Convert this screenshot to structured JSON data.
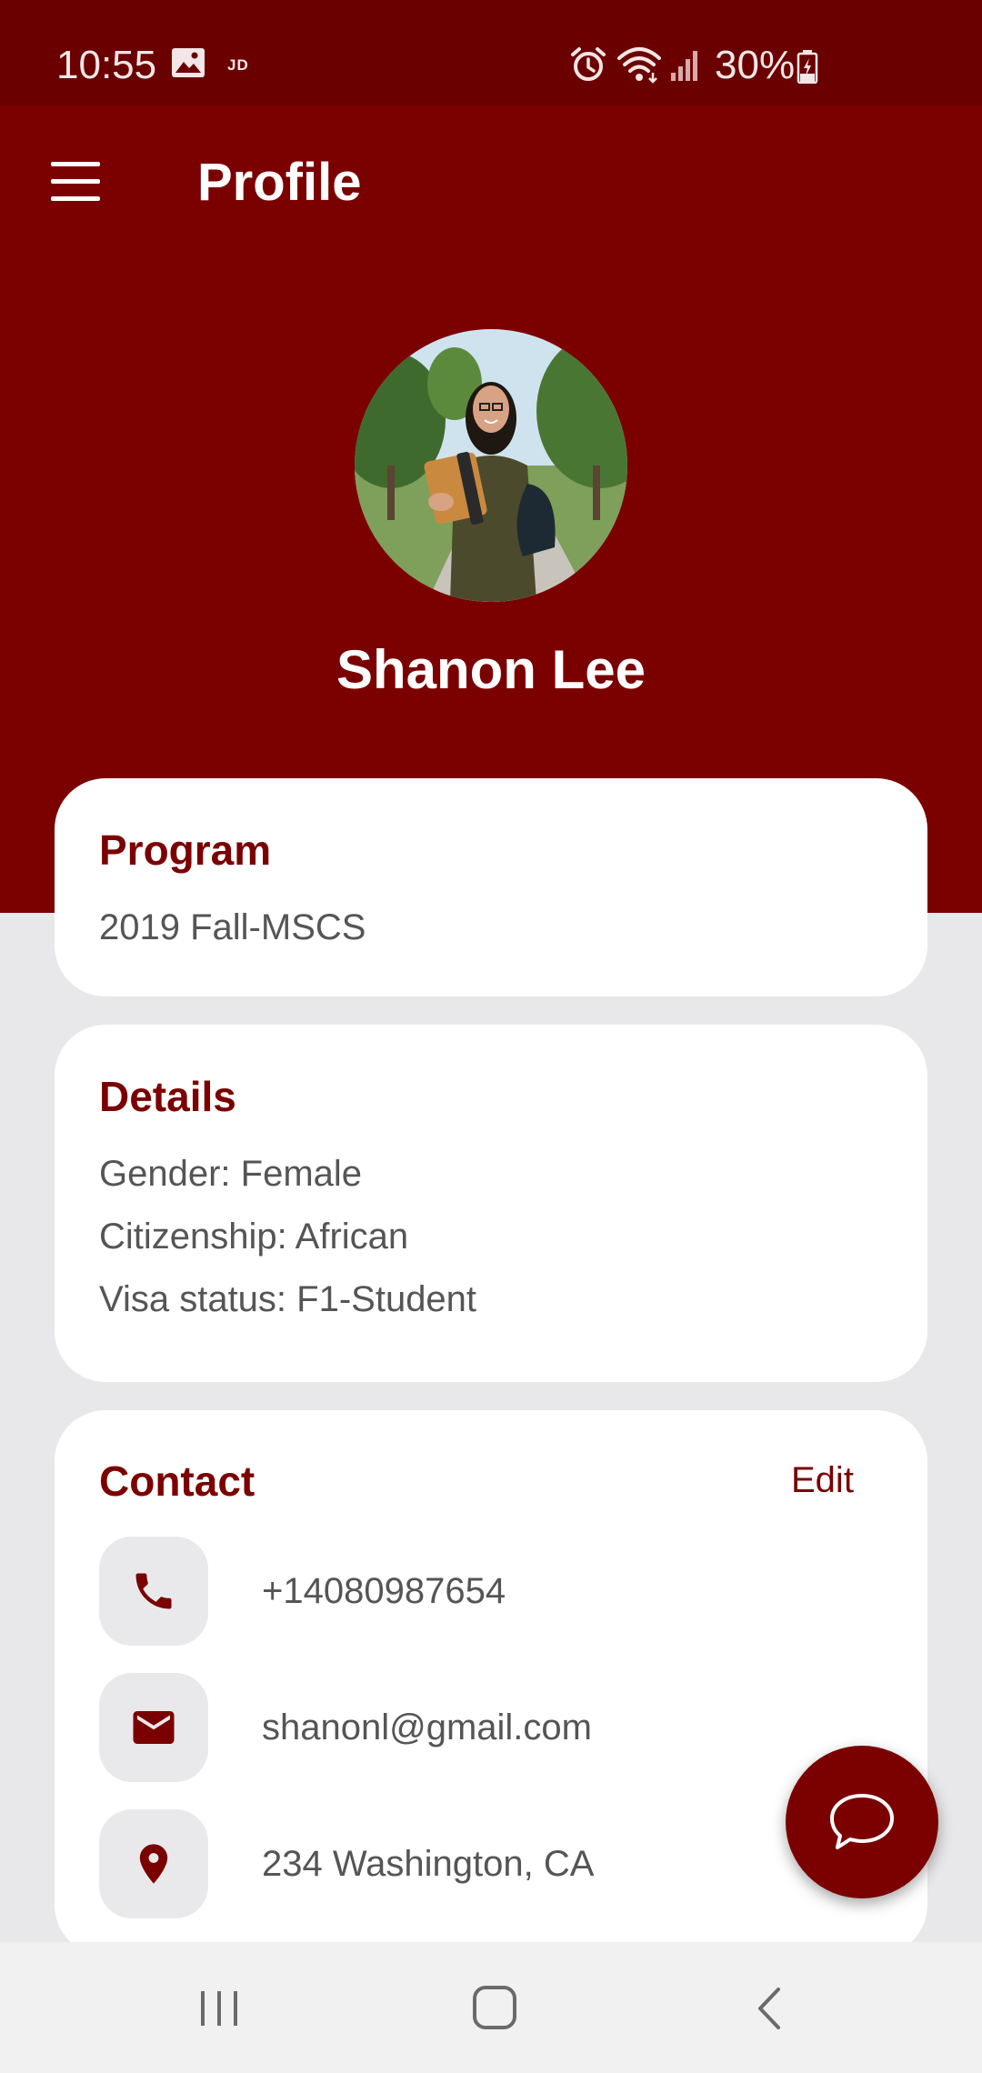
{
  "status_bar": {
    "time": "10:55",
    "notification_icons": [
      "gallery-icon",
      "jd-icon"
    ],
    "jd_label": "JD",
    "system_icons": [
      "alarm-icon",
      "wifi-icon",
      "signal-icon"
    ],
    "battery_percent": "30%",
    "battery_level": 0.3
  },
  "header": {
    "menu_icon": "hamburger-menu-icon",
    "title": "Profile"
  },
  "profile": {
    "name": "Shanon Lee",
    "avatar": "profile-photo"
  },
  "program": {
    "title": "Program",
    "value": "2019 Fall-MSCS"
  },
  "details": {
    "title": "Details",
    "items": [
      "Gender: Female",
      "Citizenship: African",
      "Visa status: F1-Student"
    ]
  },
  "contact": {
    "title": "Contact",
    "edit_label": "Edit",
    "items": [
      {
        "icon": "phone-icon",
        "value": "+14080987654"
      },
      {
        "icon": "email-icon",
        "value": "shanonl@gmail.com"
      },
      {
        "icon": "location-pin-icon",
        "value": "234 Washington, CA"
      }
    ]
  },
  "fab": {
    "icon": "chat-bubble-icon"
  },
  "nav_bar": {
    "icons": [
      "recents-icon",
      "home-icon",
      "back-icon"
    ]
  },
  "colors": {
    "brand": "#7b0000",
    "status_bar": "#6b0000",
    "background": "#e8e8ea",
    "card": "#ffffff",
    "icon_box": "#e9e9eb",
    "body_text": "#555555"
  }
}
